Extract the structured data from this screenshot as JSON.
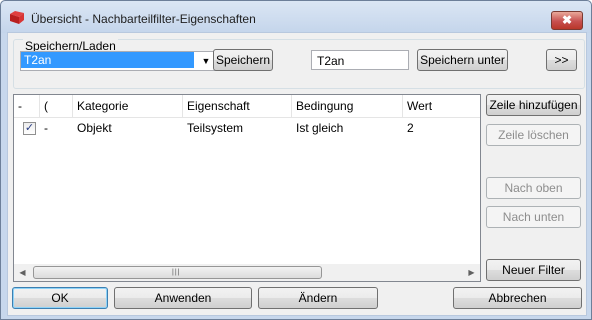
{
  "window": {
    "title": "Übersicht - Nachbarteilfilter-Eigenschaften",
    "close_glyph": "✖",
    "app_icon": "red-folder-icon"
  },
  "group": {
    "legend": "Speichern/Laden",
    "combo_value": "T2an",
    "combo_arrow": "▼",
    "save_label": "Speichern",
    "name_value": "T2an",
    "save_as_label": "Speichern unter",
    "expand_label": ">>"
  },
  "table": {
    "columns": [
      "-",
      "(",
      "Kategorie",
      "Eigenschaft",
      "Bedingung",
      "Wert"
    ],
    "rows": [
      {
        "checked": true,
        "check_glyph": "✓",
        "dash": "-",
        "kategorie": "Objekt",
        "eigenschaft": "Teilsystem",
        "bedingung": "Ist gleich",
        "wert": "2"
      }
    ],
    "scroll_left": "◀",
    "scroll_right": "▶",
    "grip": "|||"
  },
  "side_buttons": {
    "add_row": "Zeile hinzufügen",
    "delete_row": "Zeile löschen",
    "move_up": "Nach oben",
    "move_down": "Nach unten",
    "new_filter": "Neuer Filter"
  },
  "bottom_buttons": {
    "ok": "OK",
    "apply": "Anwenden",
    "modify": "Ändern",
    "cancel": "Abbrechen"
  },
  "colors": {
    "selection": "#3399ff",
    "title_gradient_top": "#dbe6f4",
    "close_red": "#c75050"
  }
}
